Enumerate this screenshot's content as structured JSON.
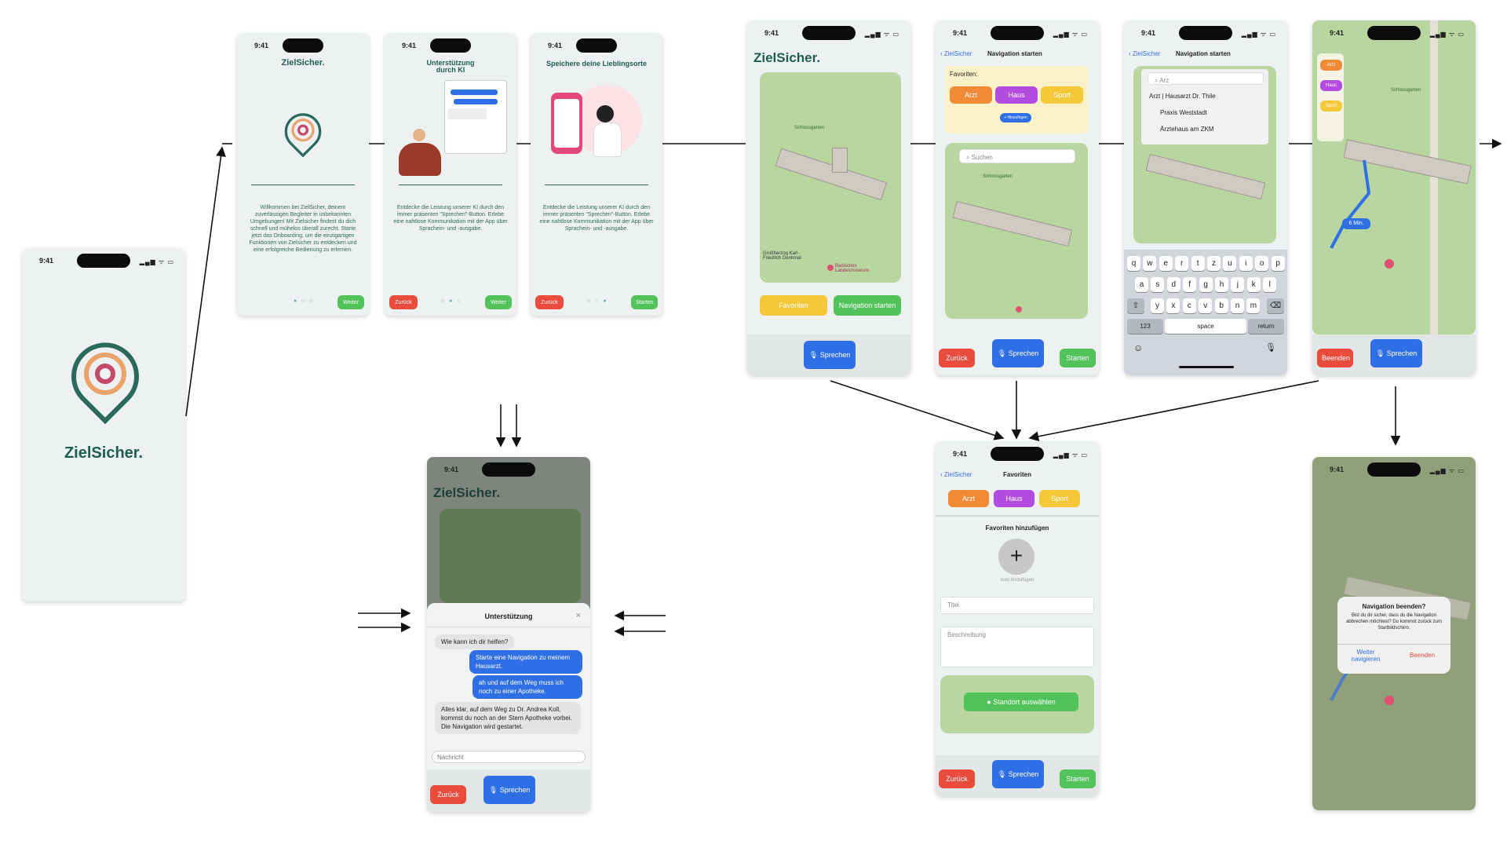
{
  "status": {
    "time": "9:41",
    "icons": "▂▄▆ ᯤ ▭"
  },
  "brand": "ZielSicher.",
  "onboarding": {
    "title1": "ZielSicher.",
    "desc1": "Willkommen bei ZielSicher, deinem zuverlässigen Begleiter in unbekannten Umgebungen! Mit Zielsicher findest du dich schnell und mühelos überall zurecht. Starte jetzt das Onboarding, um die einzigartigen Funktionen von Zielsicher zu entdecken und eine erfolgreiche Bedienung zu erlernen.",
    "title2": "Unterstützung durch KI",
    "desc2": "Entdecke die Leistung unserer KI durch den immer präsenten \"Sprechen\"-Button. Erlebe eine nahtlose Kommunikation mit der App über Sprachein- und -ausgabe.",
    "title3": "Speichere deine Lieblingsorte",
    "desc3": "Entdecke die Leistung unserer KI durch den immer präsenten \"Sprechen\"-Button. Erlebe eine nahtlose Kommunikation mit der App über Sprachein- und -ausgabe.",
    "weiter": "Weiter",
    "zurueck": "Zurück",
    "starten": "Starten"
  },
  "home": {
    "favoriten": "Favoriten",
    "nav_start": "Navigation starten",
    "sprechen": "Sprechen"
  },
  "nav": {
    "back": "ZielSicher",
    "title": "Navigation starten",
    "fav_label": "Favoriten:",
    "chips": [
      "Arzt",
      "Haus",
      "Sport"
    ],
    "add": "+ Hinzufügen",
    "search_placeholder": "Suchen",
    "zurueck": "Zurück",
    "sprechen": "Sprechen",
    "starten": "Starten"
  },
  "search": {
    "query": "Arz",
    "results": [
      "Arzt | Hausarzt Dr. Thile",
      "Praxis Weststadt",
      "Ärztehaus am ZKM"
    ],
    "keys_row1": [
      "q",
      "w",
      "e",
      "r",
      "t",
      "z",
      "u",
      "i",
      "o",
      "p"
    ],
    "keys_row2": [
      "a",
      "s",
      "d",
      "f",
      "g",
      "h",
      "j",
      "k",
      "l"
    ],
    "keys_row3": [
      "y",
      "x",
      "c",
      "v",
      "b",
      "n",
      "m"
    ],
    "k123": "123",
    "space": "space",
    "ret": "return"
  },
  "route": {
    "chips": [
      "Arzt",
      "Haus",
      "Sport"
    ],
    "eta": "6 Min.",
    "beenden": "Beenden",
    "sprechen": "Sprechen"
  },
  "map_labels": {
    "park": "Schlossgarten",
    "monument": "Großherzog Karl-Friedrich Denkmal",
    "museum": "Badisches Landesmuseum"
  },
  "assistant": {
    "title": "Unterstützung",
    "close": "×",
    "q": "Wie kann ich dir helfen?",
    "u1": "Starte eine Navigation zu meinem Hausarzt.",
    "u2": "ah und auf dem Weg muss ich noch zu einer Apotheke.",
    "a1": "Alles klar, auf dem Weg zu Dr. Andrea Koll, kommst du noch an der Stern Apotheke vorbei. Die Navigation wird gestartet.",
    "placeholder": "Nachricht",
    "zurueck": "Zurück",
    "sprechen": "Sprechen"
  },
  "favadd": {
    "back": "ZielSicher",
    "title": "Favoriten",
    "chips": [
      "Arzt",
      "Haus",
      "Sport"
    ],
    "heading": "Favoriten hinzufügen",
    "icon_label": "Icon hinzufügen",
    "titel": "Titel",
    "beschreibung": "Beschreibung",
    "standort": "Standort auswählen",
    "zurueck": "Zurück",
    "sprechen": "Sprechen",
    "starten": "Starten"
  },
  "dialog": {
    "title": "Navigation beenden?",
    "body": "Bist du dir sicher, dass du die Navigation abbrechen möchtest? Du kommst zurück zum Startbildschirm.",
    "continue": "Weiter navigieren",
    "end": "Beenden"
  },
  "colors": {
    "teal": "#1d5e52",
    "green": "#52c35a",
    "red": "#e94b3c",
    "blue": "#2f6fe6",
    "yellow": "#f5c83a"
  }
}
